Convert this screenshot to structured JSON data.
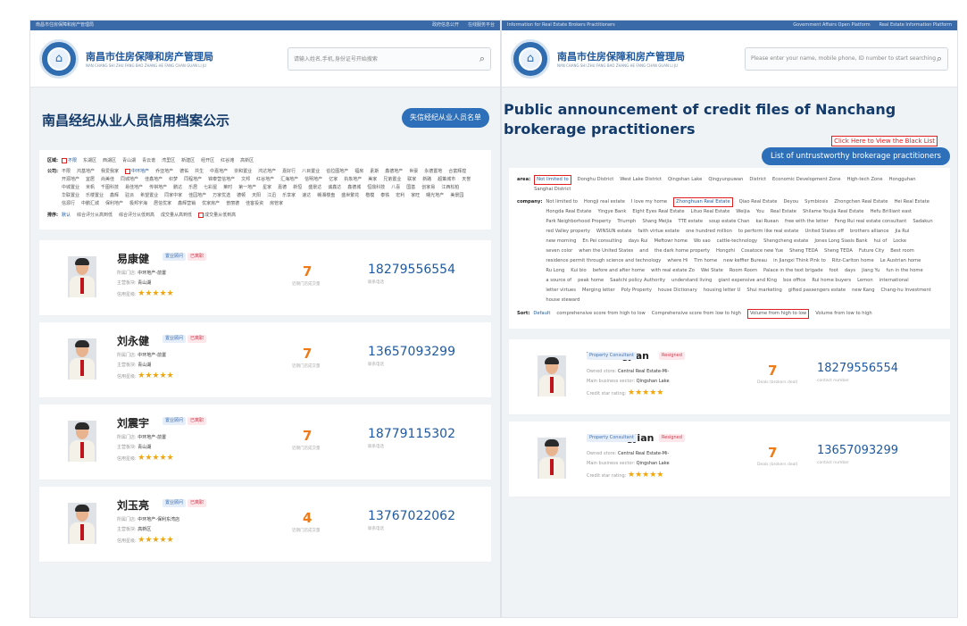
{
  "left": {
    "topbar": {
      "left": "南昌市住房保障和房产管理局",
      "right": [
        "政府信息公开",
        "在线服务平台"
      ]
    },
    "brand": {
      "title": "南昌市住房保障和房产管理局",
      "subtitle": "NAN CHANG SHI ZHU FANG BAO ZHANG HE FANG CHAN GUAN LI JU"
    },
    "search_placeholder": "请输入姓名,手机,身份证号开始搜索",
    "page_title": "南昌经纪从业人员信用档案公示",
    "blacklist_button": "失信经纪从业人员名单",
    "filter": {
      "area_label": "区域:",
      "areas": [
        "不限",
        "东湖区",
        "西湖区",
        "青山湖",
        "青云谱",
        "湾里区",
        "新建区",
        "经开区",
        "红谷滩",
        "高新区"
      ],
      "company_label": "公司:",
      "companies": [
        "不限",
        "鸿基地产",
        "我爱我家",
        "中环地产",
        "乔亚地产",
        "德佑",
        "共生",
        "中嘉地产",
        "崇和置业",
        "鸿达地产",
        "嘉好行",
        "八目置业",
        "伯拉图地产",
        "福房",
        "素斯",
        "鑫德地产",
        "世豪",
        "永德置地",
        "合富辉煌",
        "开源地产",
        "宜居",
        "尚美佳",
        "同城地产",
        "佳鑫地产",
        "织梦",
        "同程地产",
        "锦泰营信地产",
        "文邦",
        "红谷地产",
        "汇海地产",
        "信明地产",
        "亿家",
        "执象地产",
        "美家",
        "兄弟置业",
        "联家",
        "新路",
        "超策城市",
        "天誉",
        "中城置业",
        "米帆",
        "千图科技",
        "易佳地产",
        "传祺地产",
        "鹏达",
        "乐居",
        "七彩屋",
        "莱时",
        "第一地产",
        "星家",
        "嘉德",
        "新恒",
        "盛景达",
        "诚鑫达",
        "鑫德城",
        "恒鼎科技",
        "八喜",
        "国基",
        "创家易",
        "江西松柏",
        "华联置业",
        "乐楼置业",
        "鑫辉",
        "驻派",
        "希望置业",
        "同家中家",
        "佳园地产",
        "万家优选",
        "德顿",
        "天阳",
        "江迅",
        "乐享家",
        "速达",
        "赣湘楼盘",
        "盛世繁花",
        "楷模",
        "泰铁",
        "宏利",
        "家旺",
        "曙光地产",
        "美景园",
        "信源行",
        "中鹏汇城",
        "保利地产",
        "极邦宇海",
        "居信优家",
        "鑫辉营销",
        "优家房产",
        "普丽德",
        "佳客投资",
        "房管家"
      ],
      "sort_label": "排序:",
      "sorts": [
        "默认",
        "综合评分从高到低",
        "综合评分从低到高",
        "成交量从高到低",
        "成交量从低到高"
      ]
    },
    "cards": [
      {
        "name": "易康健",
        "role": "置业顾问",
        "status": "已离职",
        "store_label": "所属门店:",
        "store": "中环地产-前置",
        "sector_label": "主营板块:",
        "sector": "青山湖",
        "rating_label": "信用星级:",
        "stars": 5,
        "deals": "7",
        "deals_label": "近期门店成交量",
        "phone": "18279556554",
        "phone_label": "联系电话"
      },
      {
        "name": "刘永健",
        "role": "置业顾问",
        "status": "已离职",
        "store_label": "所属门店:",
        "store": "中环地产-前置",
        "sector_label": "主营板块:",
        "sector": "青山湖",
        "rating_label": "信用星级:",
        "stars": 5,
        "deals": "7",
        "deals_label": "近期门店成交量",
        "phone": "13657093299",
        "phone_label": "联系电话"
      },
      {
        "name": "刘震宇",
        "role": "置业顾问",
        "status": "已离职",
        "store_label": "所属门店:",
        "store": "中环地产-前置",
        "sector_label": "主营板块:",
        "sector": "青山湖",
        "rating_label": "信用星级:",
        "stars": 5,
        "deals": "7",
        "deals_label": "近期门店成交量",
        "phone": "18779115302",
        "phone_label": "联系电话"
      },
      {
        "name": "刘玉亮",
        "role": "置业顾问",
        "status": "已离职",
        "store_label": "所属门店:",
        "store": "中环地产-保利东湾店",
        "sector_label": "主营板块:",
        "sector": "高新区",
        "rating_label": "信用星级:",
        "stars": 5,
        "deals": "4",
        "deals_label": "近期门店成交量",
        "phone": "13767022062",
        "phone_label": "联系电话"
      }
    ]
  },
  "right": {
    "topbar": {
      "left": "Information for Real Estate Brokers Practitioners",
      "right": [
        "Government Affairs Open Platform",
        "Real Estate Information Platform"
      ]
    },
    "brand": {
      "title": "南昌市住房保障和房产管理局",
      "subtitle": "NAN CHANG SHI ZHU FANG BAO ZHANG HE FANG CHAN GUAN LI JU"
    },
    "search_placeholder": "Please enter your name, mobile phone, ID number to start searching",
    "page_title": "Public announcement of credit files of Nanchang brokerage practitioners",
    "click_note": "Click Here to View the Black List",
    "blacklist_button": "List of untrustworthy brokerage practitioners",
    "filter": {
      "area_label": "area:",
      "areas": [
        "Not limited to",
        "Donghu District",
        "West Lake District",
        "Qingshan Lake",
        "Qingyunpuwan",
        "District",
        "Economic Development Zone",
        "High-tech Zone",
        "Hongguhan",
        "Sanghai District"
      ],
      "company_label": "company:",
      "companies": [
        "Not limited to",
        "Hongji real estate",
        "I love my home",
        "Zhonghuan Real Estate",
        "Qiao Real Estate",
        "Deyou",
        "Symbiosis",
        "Zhongchen Real Estate",
        "Hei Real Estate",
        "Hongda Real Estate",
        "Yingye Bank",
        "Eight Eyes Real Estate",
        "Lituo Real Estate",
        "Weijia",
        "You",
        "Real Estate",
        "Shilame Youjia Real Estate",
        "Hefu Brilliant east",
        "Park Neighborhood Property",
        "Triumph",
        "Shang Meijia",
        "TTE estate",
        "soup estate Chan",
        "kai Ruean",
        "free with the letter",
        "Feng Rui real estate consultant",
        "Sadakun",
        "red Valley property",
        "WINSUN estate",
        "faith virtue estate",
        "one hundred million",
        "to perform like real estate",
        "United States off",
        "brothers alliance",
        "Jia Rui",
        "new morning",
        "En Pei consulting",
        "days Rui",
        "Meftowr home",
        "Wo sao",
        "cattle-technology",
        "Shengcheng estate",
        "Jones Long Siasis Bank",
        "hui of",
        "Locke",
        "seven color",
        "when the United States",
        "and",
        "the dark home property",
        "Hongzhi",
        "Cosatoce new Yue",
        "Sheng TEDA",
        "Sheng TEDA",
        "Future City",
        "Best room",
        "residence permit through science and technology",
        "where Hi",
        "Tim home",
        "new keffier Bureau",
        "in Jiangxi Think Pink to",
        "Ritz-Carlton home",
        "Le Austrian home",
        "Ru Long",
        "Kui bio",
        "before and after home",
        "with real estate Zo",
        "Wei State",
        "Room Room",
        "Palace in the text brigade",
        "foot",
        "days",
        "Jiang Yu",
        "fun in the home",
        "a source of",
        "peak home",
        "Saatchi policy Authority",
        "understand living",
        "giant expensive and King",
        "box office",
        "Rui home buyers",
        "Lemon",
        "international",
        "letter virtues",
        "Merging letter",
        "Poly Property",
        "house Dictionary",
        "housing letter U",
        "Shui marketing",
        "gifted passengers estate",
        "new Kang",
        "Chang-hu Investment",
        "house steward"
      ],
      "sort_label": "Sort:",
      "sorts": [
        "Default",
        "comprehensive score from high to low",
        "Comprehensive score from low to high",
        "Volume from high to low",
        "Volume from low to high"
      ]
    },
    "cards": [
      {
        "name": "Yi Kangjian",
        "role": "Property Consultant",
        "status": "Resigned",
        "store_label": "Owned store:",
        "store": "Central Real Estate-Mi-",
        "sector_label": "Main business sector:",
        "sector": "Qingshan Lake",
        "rating_label": "Credit star rating:",
        "stars": 5,
        "deals": "7",
        "deals_label": "Deals (brokers deal)",
        "phone": "18279556554",
        "phone_label": "contact number"
      },
      {
        "name": "Liu Yongjian",
        "role": "Property Consultant",
        "status": "Resigned",
        "store_label": "Owned store:",
        "store": "Central Real Estate-Mi-",
        "sector_label": "Main business sector:",
        "sector": "Qingshan Lake",
        "rating_label": "Credit star rating:",
        "stars": 5,
        "deals": "7",
        "deals_label": "Deals (brokers deal)",
        "phone": "13657093299",
        "phone_label": "contact number"
      }
    ]
  },
  "colors": {
    "accent": "#2d6fb8",
    "score": "#ef7a16",
    "highlight_box": "#e02020",
    "star": "#f2a50c"
  },
  "icons": {
    "search": "magnifier-icon",
    "logo": "bureau-emblem-icon"
  }
}
